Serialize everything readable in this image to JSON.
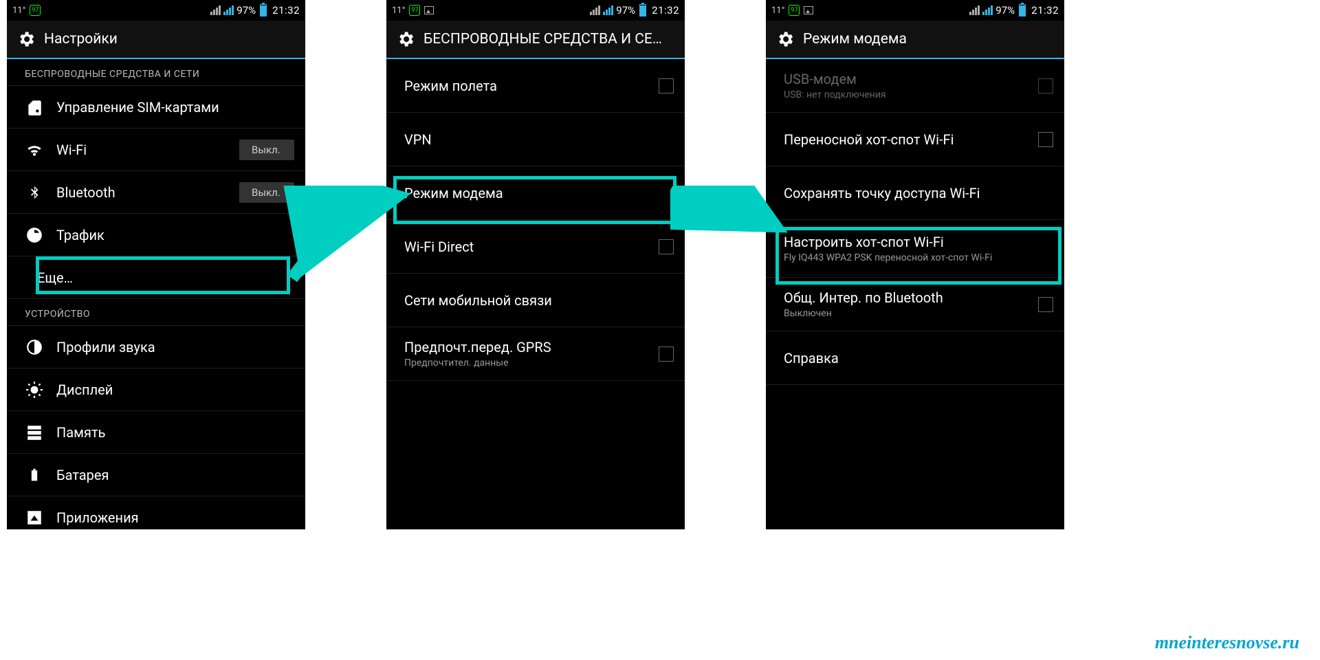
{
  "status": {
    "temp": "11°",
    "badge": "97",
    "battery_pct": "97%",
    "time": "21:32"
  },
  "screen1": {
    "title": "Настройки",
    "section1": "БЕСПРОВОДНЫЕ СРЕДСТВА И СЕТИ",
    "sim": "Управление SIM-картами",
    "wifi": "Wi-Fi",
    "wifi_state": "Выкл.",
    "bt": "Bluetooth",
    "bt_state": "Выкл.",
    "traffic": "Трафик",
    "more": "Еще…",
    "section2": "УСТРОЙСТВО",
    "sound": "Профили звука",
    "display": "Дисплей",
    "memory": "Память",
    "battery": "Батарея",
    "apps": "Приложения"
  },
  "screen2": {
    "title": "БЕСПРОВОДНЫЕ СРЕДСТВА И СЕ…",
    "airplane": "Режим полета",
    "vpn": "VPN",
    "tether": "Режим модема",
    "wifidirect": "Wi-Fi Direct",
    "mobile": "Сети мобильной связи",
    "gprs": "Предпочт.перед. GPRS",
    "gprs_sub": "Предпочтител. данные"
  },
  "screen3": {
    "title": "Режим модема",
    "usb": "USB-модем",
    "usb_sub": "USB: нет подключения",
    "hotspot": "Переносной хот-спот Wi-Fi",
    "keep": "Сохранять точку доступа Wi-Fi",
    "setup": "Настроить хот-спот Wi-Fi",
    "setup_sub": "Fly IQ443 WPA2 PSK переносной хот-спот Wi-Fi",
    "bt": "Общ. Интер. по Bluetooth",
    "bt_sub": "Выключен",
    "help": "Справка"
  },
  "watermark": "mneinteresnovse.ru"
}
